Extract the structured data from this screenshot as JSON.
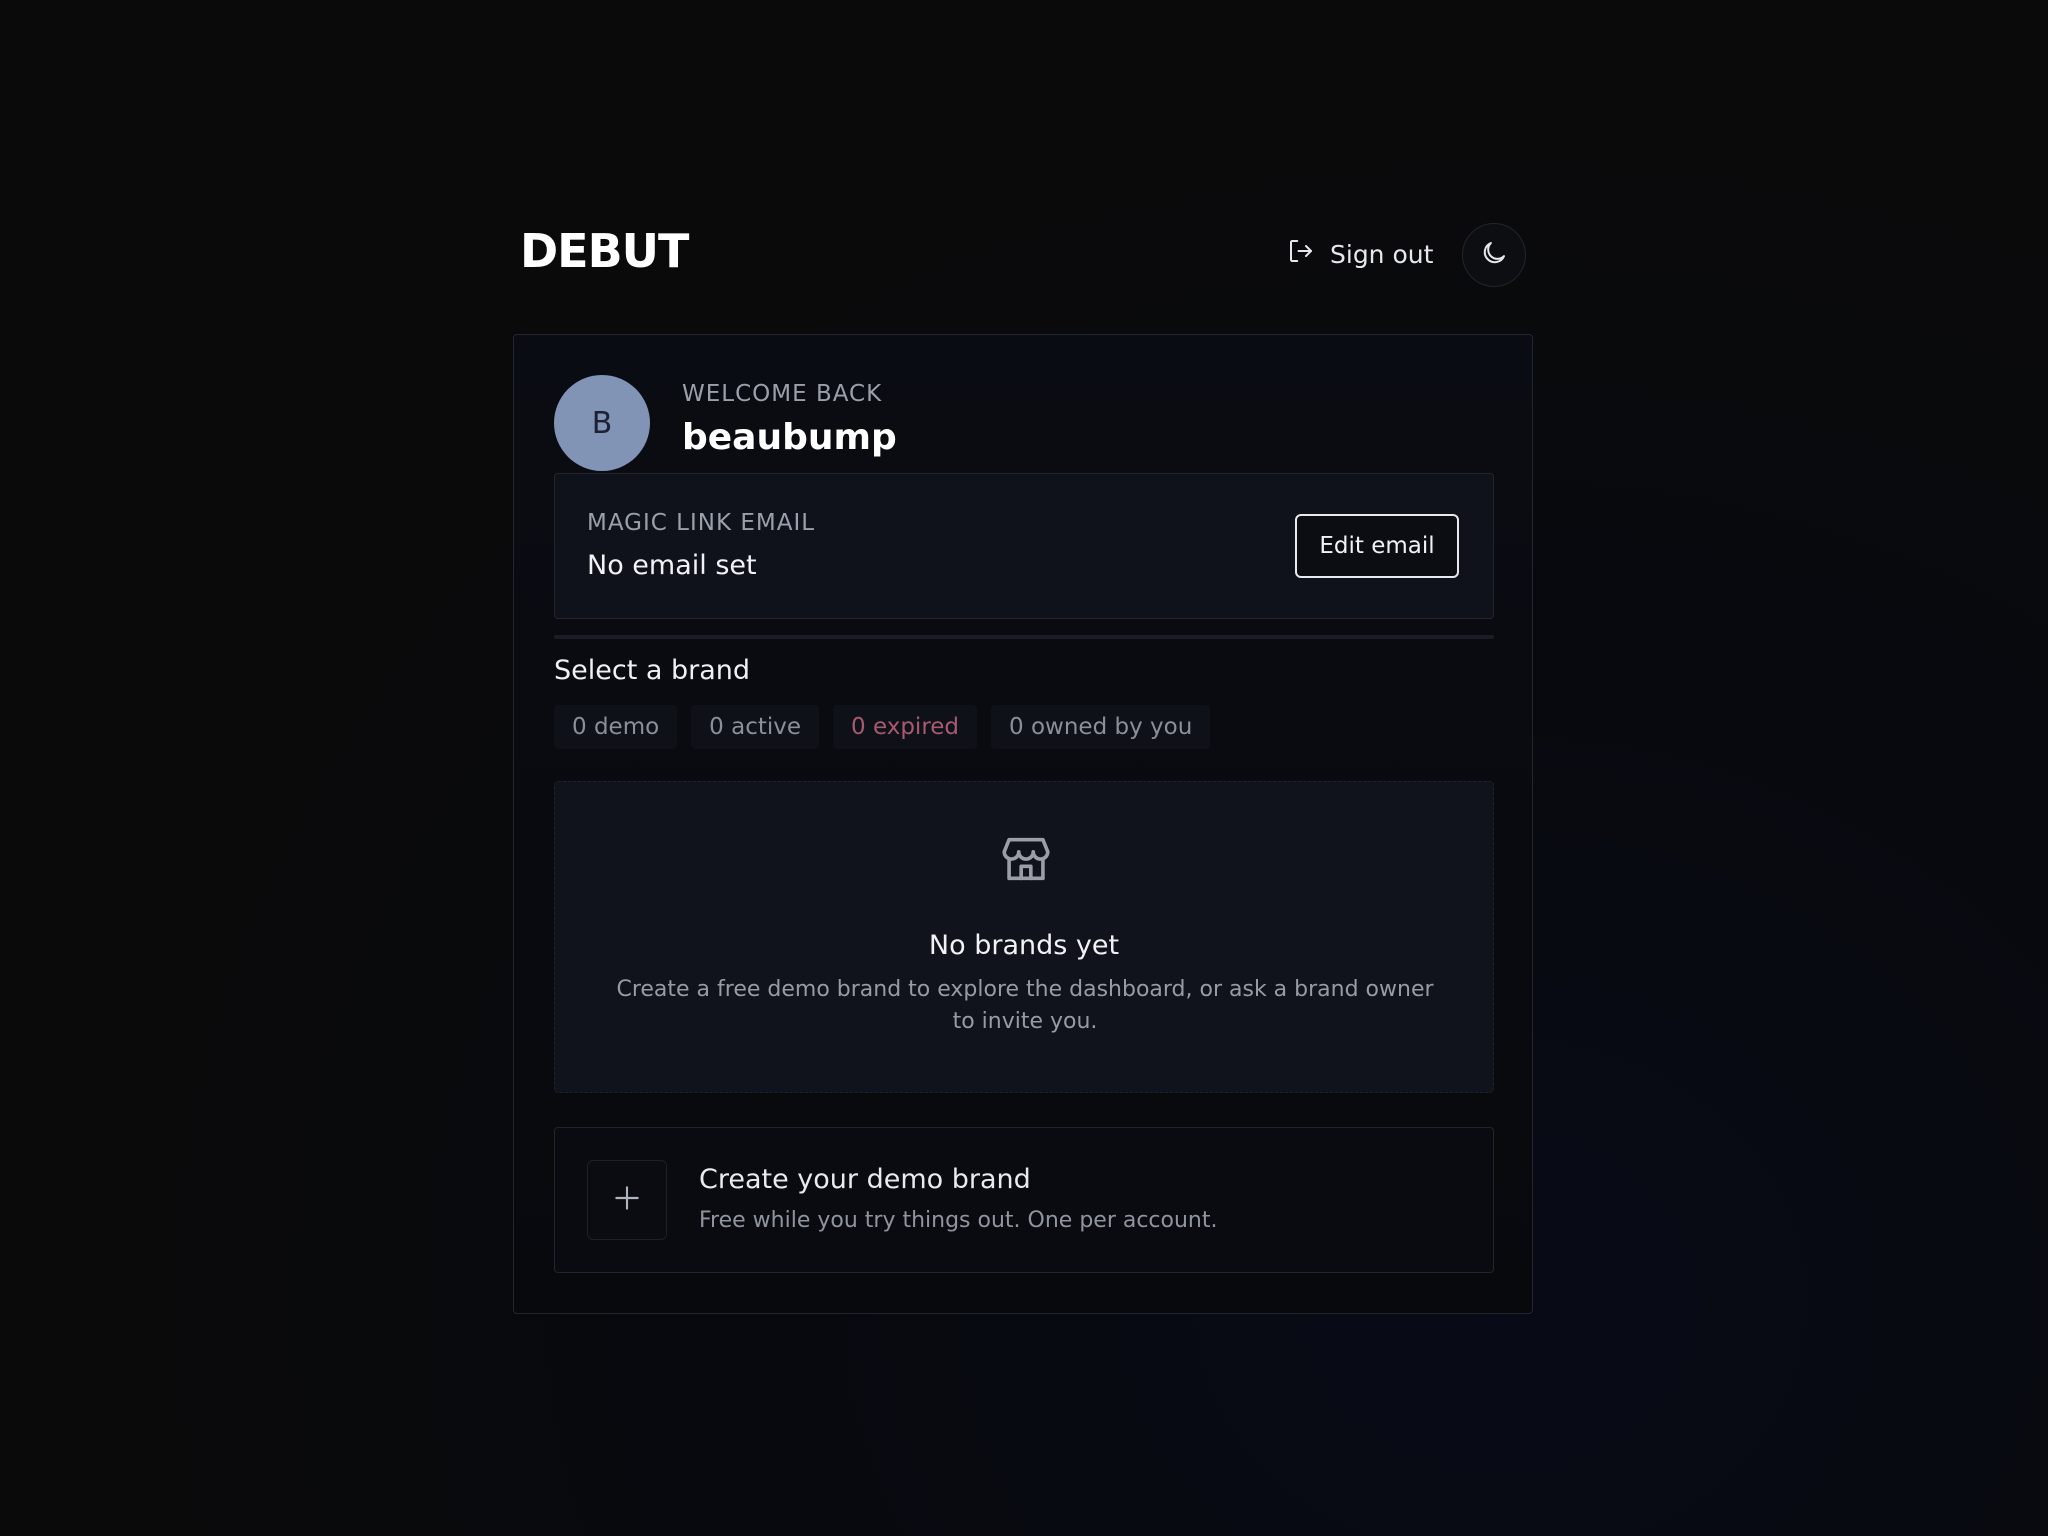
{
  "app": {
    "logo": "DEBUT"
  },
  "header": {
    "sign_out_label": "Sign out",
    "theme_icon": "moon-icon",
    "sign_out_icon": "sign-out-icon"
  },
  "user": {
    "avatar_initial": "B",
    "welcome_label": "WELCOME BACK",
    "username": "beaubump"
  },
  "email_panel": {
    "label": "MAGIC LINK EMAIL",
    "value": "No email set",
    "edit_label": "Edit email"
  },
  "brands": {
    "section_title": "Select a brand",
    "filters": [
      {
        "label": "0 demo"
      },
      {
        "label": "0 active"
      },
      {
        "label": "0 expired"
      },
      {
        "label": "0 owned by you"
      }
    ],
    "empty_state": {
      "icon": "store-icon",
      "title": "No brands yet",
      "description": "Create a free demo brand to explore the dashboard, or ask a brand owner to invite you."
    },
    "create": {
      "icon": "plus-icon",
      "title": "Create your demo brand",
      "description": "Free while you try things out. One per account."
    }
  },
  "colors": {
    "background": "#0a0a0b",
    "avatar": "#8194b6",
    "expired_accent": "#a65a6e",
    "text_primary": "#ffffff",
    "text_muted": "#9aa0ab"
  }
}
